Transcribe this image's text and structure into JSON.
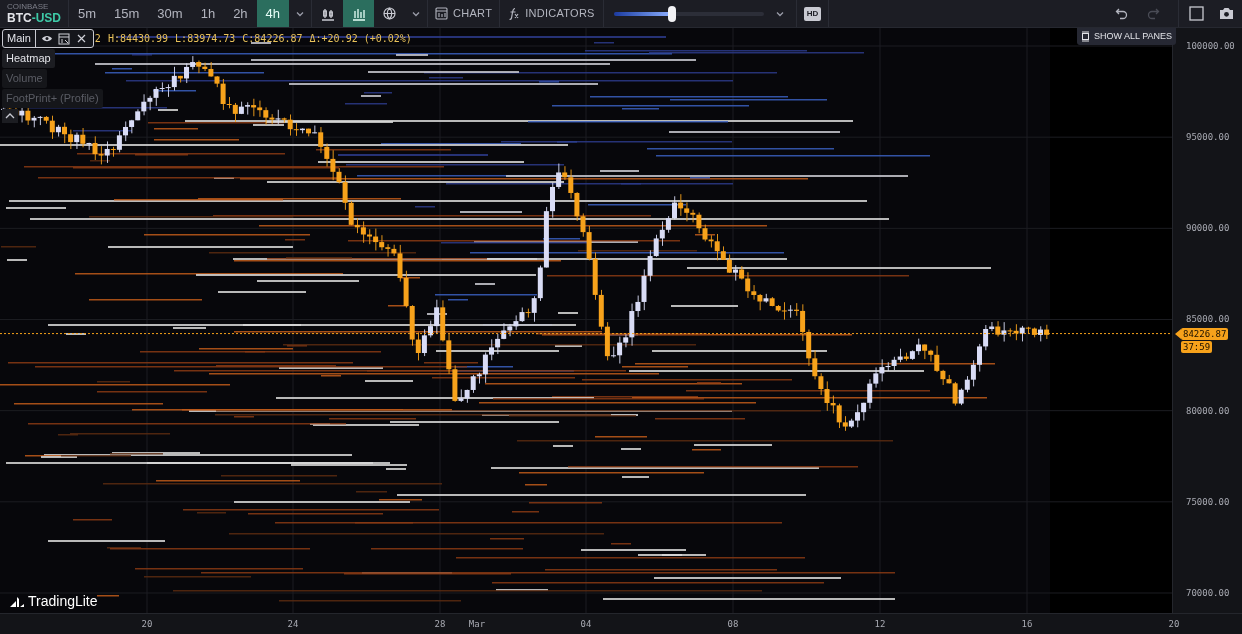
{
  "toolbar": {
    "exchange": "COINBASE",
    "symbol": {
      "base": "BTC",
      "quote": "-USD"
    },
    "intervals": [
      {
        "label": "5m",
        "selected": false
      },
      {
        "label": "15m",
        "selected": false
      },
      {
        "label": "30m",
        "selected": false
      },
      {
        "label": "1h",
        "selected": false
      },
      {
        "label": "2h",
        "selected": false
      },
      {
        "label": "4h",
        "selected": true
      }
    ],
    "chart_styles": [
      {
        "kind": "candles",
        "selected": false
      },
      {
        "kind": "bars",
        "selected": true
      },
      {
        "kind": "globe",
        "selected": false
      }
    ],
    "chart_button": "CHART",
    "indicators_button": "INDICATORS",
    "opacity_slider": {
      "level": 0.39
    },
    "hd_badge": "HD",
    "redo_disabled": true
  },
  "legend": {
    "pane": "Main",
    "ohlc_fragment": "2",
    "ohlc": [
      "H:84430.99",
      "L:83974.73",
      "C:84226.87",
      "Δ:+20.92 (+0.02%)"
    ],
    "layers": [
      {
        "label": "Heatmap",
        "visible": true
      },
      {
        "label": "Volume",
        "visible": false
      },
      {
        "label": "FootPrint+ (Profile)",
        "visible": false
      }
    ]
  },
  "show_all_panes": "SHOW ALL PANES",
  "watermark": "TradingLite",
  "price_axis": {
    "labels": [
      "100000.00",
      "95000.00",
      "90000.00",
      "85000.00",
      "80000.00",
      "75000.00",
      "70000.00"
    ]
  },
  "current_price": {
    "price": "84226.87",
    "countdown": "37:59"
  },
  "time_axis": {
    "labels": [
      "20",
      "24",
      "28",
      "Mar",
      "04",
      "08",
      "12",
      "16",
      "20"
    ]
  }
}
